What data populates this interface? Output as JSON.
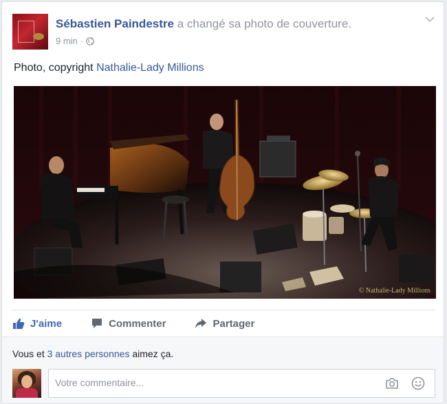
{
  "post": {
    "author": "Sébastien Paindestre",
    "action_text": "a changé sa photo de couverture.",
    "time": "9 min",
    "separator": "·",
    "caption_prefix": "Photo, copyright ",
    "caption_link": "Nathalie-Lady Millions",
    "photo_watermark": "© Nathalie-Lady Millions",
    "icons": {
      "privacy": "globe-icon",
      "menu": "chevron-down-icon"
    }
  },
  "actions": {
    "like": "J'aime",
    "comment": "Commenter",
    "share": "Partager"
  },
  "reactions": {
    "prefix": "Vous et ",
    "link": "3 autres personnes",
    "suffix": " aimez ça."
  },
  "comment": {
    "placeholder": "Votre commentaire...",
    "value": ""
  },
  "colors": {
    "link": "#365899",
    "like_active": "#4267b2",
    "muted": "#90949c"
  }
}
